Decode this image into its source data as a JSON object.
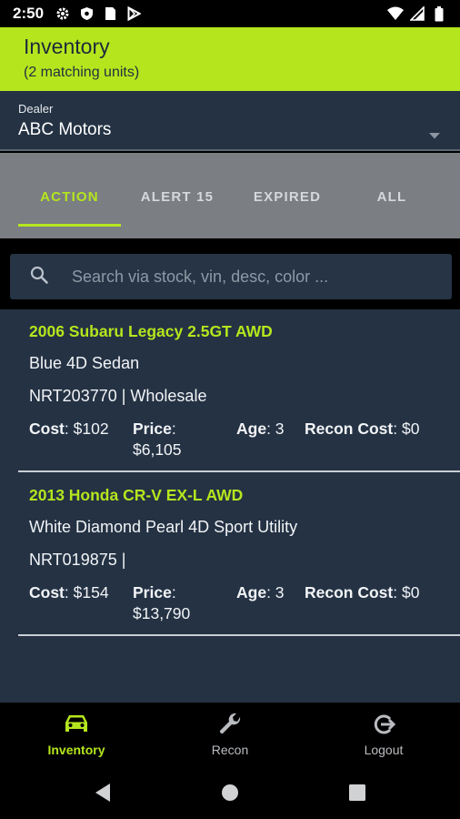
{
  "status_bar": {
    "time": "2:50",
    "icons": [
      "gear-icon",
      "shield-icon",
      "sim-card-icon",
      "play-store-icon",
      "wifi-icon",
      "signal-icon",
      "battery-icon"
    ]
  },
  "header": {
    "title": "Inventory",
    "subtitle": "(2 matching units)"
  },
  "dealer": {
    "label": "Dealer",
    "value": "ABC Motors"
  },
  "tabs": [
    {
      "label": "ACTION",
      "active": true
    },
    {
      "label": "ALERT 15",
      "active": false
    },
    {
      "label": "EXPIRED",
      "active": false
    },
    {
      "label": "ALL",
      "active": false
    }
  ],
  "search": {
    "placeholder": "Search via stock, vin, desc, color ..."
  },
  "units": [
    {
      "title": "2006 Subaru Legacy 2.5GT AWD",
      "description": "Blue 4D Sedan",
      "stock_line": "NRT203770 | Wholesale",
      "cost_label": "Cost",
      "cost": ": $102",
      "price_label": "Price",
      "price": ":",
      "price_value": "$6,105",
      "age_label": "Age",
      "age": ": 3",
      "recon_label": "Recon Cost",
      "recon": ": $0"
    },
    {
      "title": "2013 Honda CR-V EX-L AWD",
      "description": "White Diamond Pearl 4D Sport Utility",
      "stock_line": "NRT019875 |",
      "cost_label": "Cost",
      "cost": ": $154",
      "price_label": "Price",
      "price": ":",
      "price_value": "$13,790",
      "age_label": "Age",
      "age": ": 3",
      "recon_label": "Recon Cost",
      "recon": ": $0"
    }
  ],
  "bottom_nav": [
    {
      "label": "Inventory",
      "icon": "car-icon",
      "active": true
    },
    {
      "label": "Recon",
      "icon": "wrench-icon",
      "active": false
    },
    {
      "label": "Logout",
      "icon": "logout-icon",
      "active": false
    }
  ],
  "colors": {
    "accent": "#b5e61d",
    "header_bg": "#b5e61d",
    "panel_bg": "#243244",
    "tabs_bg": "#7b7e82"
  }
}
